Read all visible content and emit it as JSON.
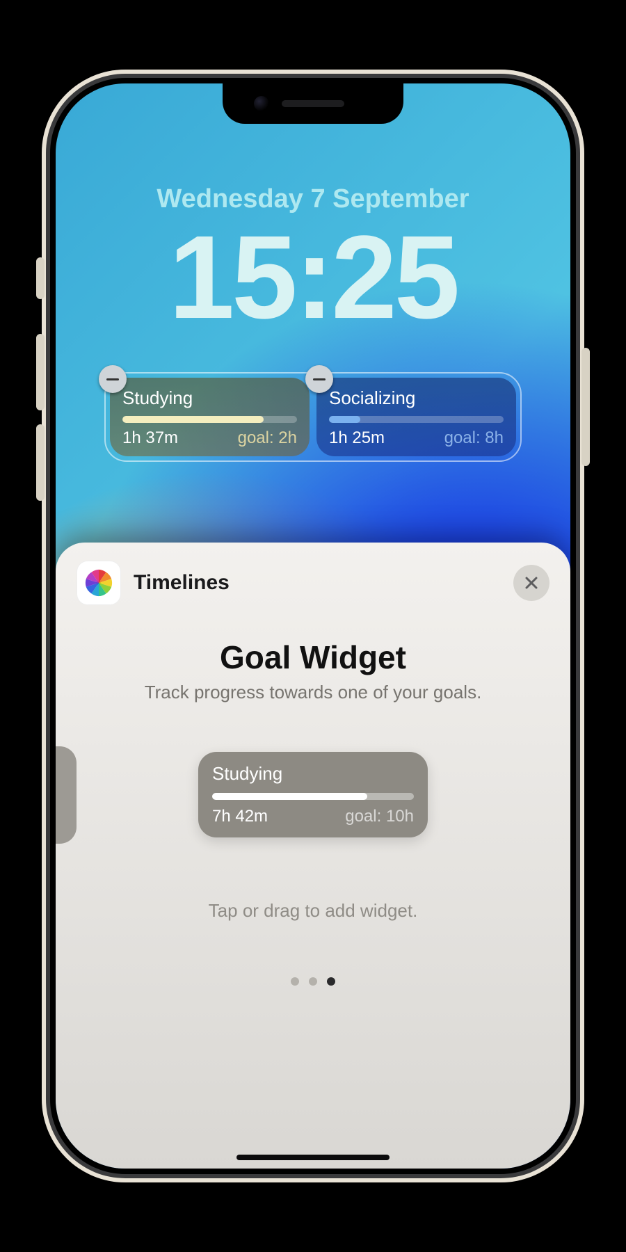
{
  "lock_screen": {
    "date": "Wednesday 7 September",
    "time": "15:25",
    "widgets": [
      {
        "title": "Studying",
        "elapsed": "1h 37m",
        "goal": "goal: 2h",
        "progress_pct": 81
      },
      {
        "title": "Socializing",
        "elapsed": "1h 25m",
        "goal": "goal: 8h",
        "progress_pct": 18
      }
    ]
  },
  "sheet": {
    "app_name": "Timelines",
    "title": "Goal Widget",
    "subtitle": "Track progress towards one of your goals.",
    "hint": "Tap or drag to add widget.",
    "preview": {
      "title": "Studying",
      "elapsed": "7h 42m",
      "goal": "goal: 10h",
      "progress_pct": 77
    },
    "page_count": 3,
    "active_page_index": 2
  },
  "colors": {
    "study_bar": "#f4eebf",
    "social_bar": "#7bb2ef"
  }
}
